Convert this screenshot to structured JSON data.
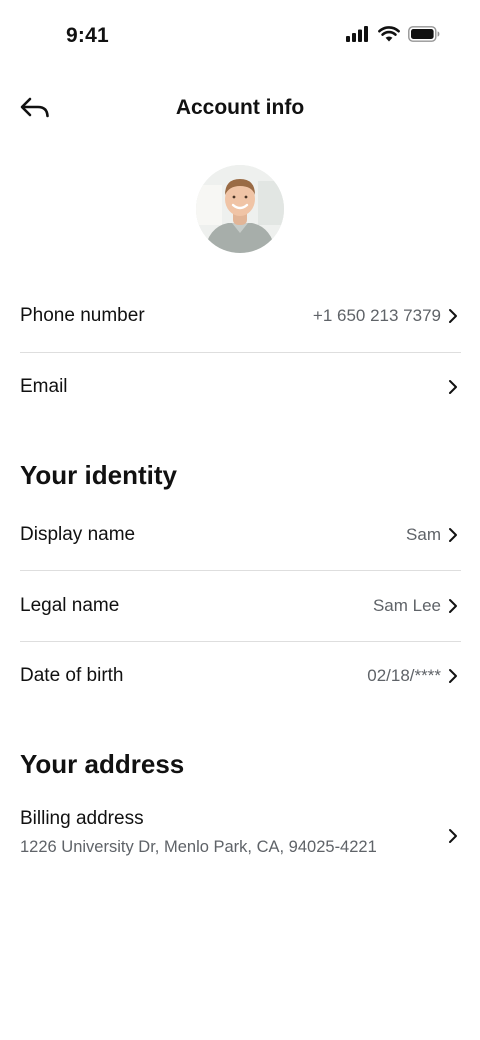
{
  "status_bar": {
    "time": "9:41",
    "icons": [
      "cellular-signal-icon",
      "wifi-icon",
      "battery-icon"
    ]
  },
  "header": {
    "title": "Account info",
    "back_icon": "back-arrow-icon"
  },
  "profile": {
    "avatar": "avatar-photo"
  },
  "contact": {
    "phone": {
      "label": "Phone number",
      "value": "+1 650 213 7379"
    },
    "email": {
      "label": "Email",
      "value": ""
    }
  },
  "identity": {
    "heading": "Your identity",
    "display_name": {
      "label": "Display name",
      "value": "Sam"
    },
    "legal_name": {
      "label": "Legal name",
      "value": "Sam Lee"
    },
    "date_of_birth": {
      "label": "Date of birth",
      "value": "02/18/****"
    }
  },
  "address": {
    "heading": "Your address",
    "billing": {
      "label": "Billing address",
      "value": "1226 University Dr, Menlo Park, CA, 94025-4221"
    }
  },
  "colors": {
    "text_primary": "#111111",
    "text_secondary": "#5f6368",
    "divider": "#dedede",
    "background": "#ffffff"
  }
}
